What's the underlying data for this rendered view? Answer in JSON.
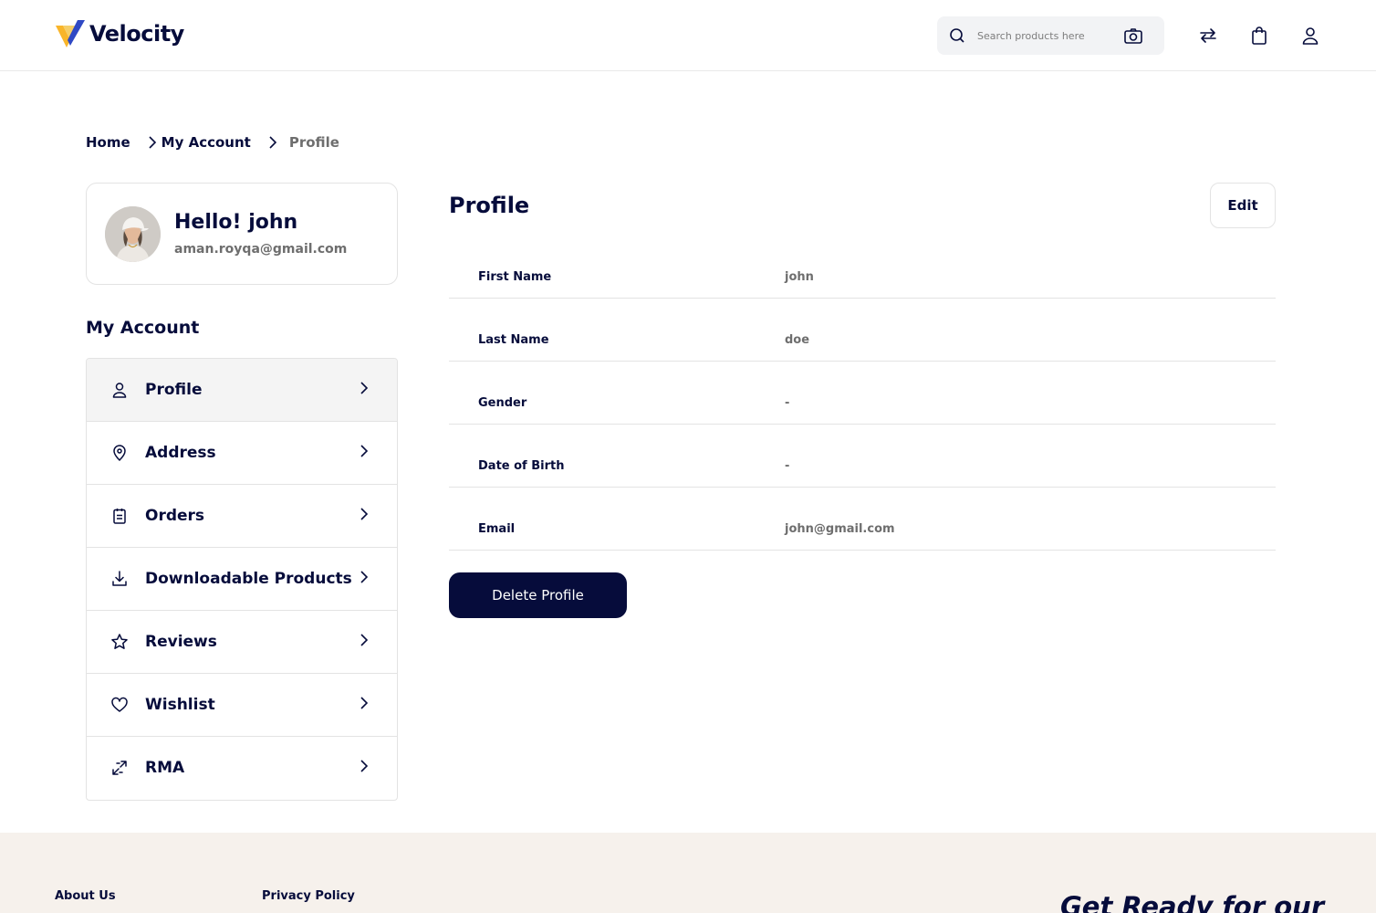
{
  "header": {
    "brand": "Velocity",
    "search_placeholder": "Search products here",
    "icons": [
      "compare-icon",
      "bag-icon",
      "user-icon"
    ]
  },
  "breadcrumb": [
    {
      "label": "Home"
    },
    {
      "label": "My Account"
    },
    {
      "label": "Profile",
      "current": true
    }
  ],
  "user": {
    "greeting": "Hello! john",
    "email": "aman.royqa@gmail.com"
  },
  "sidebar": {
    "title": "My Account",
    "items": [
      {
        "label": "Profile",
        "icon": "user-icon",
        "active": true
      },
      {
        "label": "Address",
        "icon": "location-pin-icon"
      },
      {
        "label": "Orders",
        "icon": "clipboard-icon"
      },
      {
        "label": "Downloadable Products",
        "icon": "download-icon"
      },
      {
        "label": "Reviews",
        "icon": "star-icon"
      },
      {
        "label": "Wishlist",
        "icon": "heart-icon"
      },
      {
        "label": "RMA",
        "icon": "return-arrows-icon"
      }
    ]
  },
  "profile": {
    "title": "Profile",
    "edit_label": "Edit",
    "fields": [
      {
        "label": "First Name",
        "value": "john"
      },
      {
        "label": "Last Name",
        "value": "doe"
      },
      {
        "label": "Gender",
        "value": "-"
      },
      {
        "label": "Date of Birth",
        "value": "-"
      },
      {
        "label": "Email",
        "value": "john@gmail.com"
      }
    ],
    "delete_label": "Delete Profile"
  },
  "footer": {
    "links": [
      "About Us",
      "Privacy Policy"
    ],
    "promo": "Get Ready for our"
  },
  "colors": {
    "navy": "#060c3b",
    "muted": "#6e6e6e",
    "footer_bg": "#f6f1ec",
    "logo_yellow": "#f9b52a",
    "logo_blue": "#2f49c4"
  }
}
